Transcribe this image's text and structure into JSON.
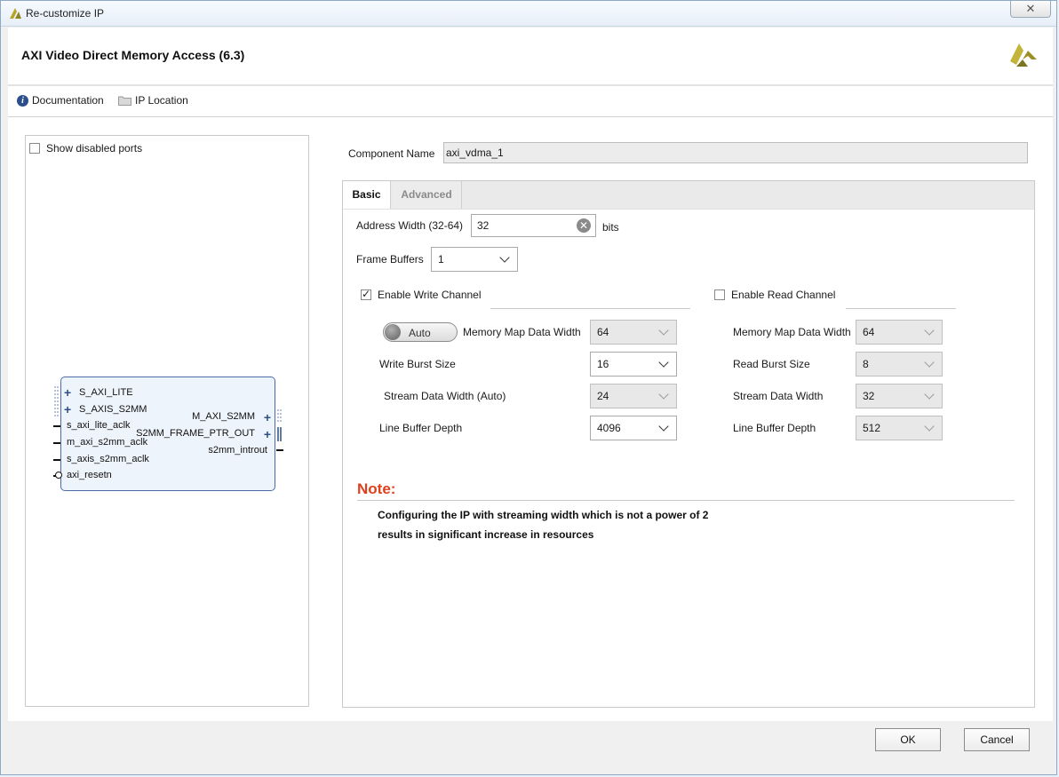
{
  "window": {
    "title": "Re-customize IP",
    "close_symbol": "✕"
  },
  "header": {
    "title": "AXI Video Direct Memory Access (6.3)"
  },
  "docbar": {
    "documentation": "Documentation",
    "ip_location": "IP Location"
  },
  "left_pane": {
    "show_disabled_ports": "Show disabled ports",
    "show_disabled_checked": false,
    "block": {
      "inputs": [
        "S_AXI_LITE",
        "S_AXIS_S2MM",
        "s_axi_lite_aclk",
        "m_axi_s2mm_aclk",
        "s_axis_s2mm_aclk",
        "axi_resetn"
      ],
      "outputs": [
        "M_AXI_S2MM",
        "S2MM_FRAME_PTR_OUT",
        "s2mm_introut"
      ]
    }
  },
  "component": {
    "label": "Component Name",
    "value": "axi_vdma_1"
  },
  "tabs": {
    "basic": "Basic",
    "advanced": "Advanced",
    "active": "Basic"
  },
  "basic": {
    "address_width_label": "Address Width (32-64)",
    "address_width_value": "32",
    "address_width_unit": "bits",
    "frame_buffers_label": "Frame Buffers",
    "frame_buffers_value": "1",
    "write": {
      "enable_label": "Enable Write Channel",
      "enabled": true,
      "auto_toggle": "Auto",
      "mm_width_label": "Memory Map Data Width",
      "mm_width_value": "64",
      "burst_label": "Write Burst Size",
      "burst_value": "16",
      "stream_width_label": "Stream Data Width (Auto)",
      "stream_width_value": "24",
      "line_buffer_label": "Line Buffer Depth",
      "line_buffer_value": "4096"
    },
    "read": {
      "enable_label": "Enable Read Channel",
      "enabled": false,
      "mm_width_label": "Memory Map Data Width",
      "mm_width_value": "64",
      "burst_label": "Read Burst Size",
      "burst_value": "8",
      "stream_width_label": "Stream Data Width",
      "stream_width_value": "32",
      "line_buffer_label": "Line Buffer Depth",
      "line_buffer_value": "512"
    },
    "note": {
      "title": "Note:",
      "line1": "Configuring the IP with streaming width which is not a power of 2",
      "line2": "results in significant increase in resources"
    }
  },
  "footer": {
    "ok": "OK",
    "cancel": "Cancel"
  },
  "colors": {
    "note_title": "#e0401c",
    "block_border": "#4b6aa6",
    "port_plus": "#2b4f86"
  }
}
